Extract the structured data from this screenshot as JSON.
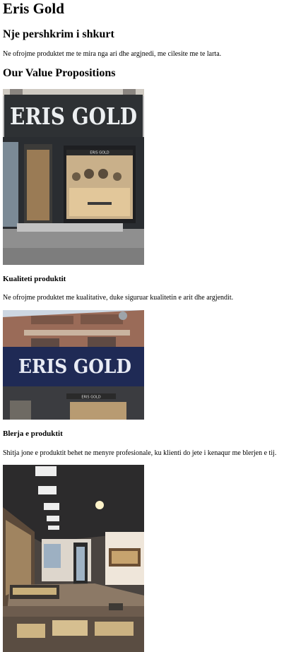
{
  "page": {
    "title": "Eris Gold",
    "intro_heading": "Nje pershkrim i shkurt",
    "intro_text": "Ne ofrojme produktet me te mira nga ari dhe argjnedi, me cilesite me te larta.",
    "value_heading": "Our Value Propositions"
  },
  "store_sign_text": "ERIS GOLD",
  "storefront_small_text": "ERIS GOLD",
  "sections": [
    {
      "heading": "Kualiteti produktit",
      "text": "Ne ofrojme produktet me kualitative, duke siguruar kualitetin e arit dhe argjendit."
    },
    {
      "heading": "Blerja e produktit",
      "text": "Shitja jone e produktit behet ne menyre profesionale, ku klienti do jete i kenaqur me blerjen e tij."
    }
  ],
  "colors": {
    "sign_dark": "#2e3134",
    "sign_text": "#eceff1",
    "awning_navy": "#1f2a55",
    "shop_wood": "#d9b88a",
    "pavement": "#8f8f8f",
    "building_brick": "#9a6b58",
    "sky": "#cdd7e2"
  }
}
